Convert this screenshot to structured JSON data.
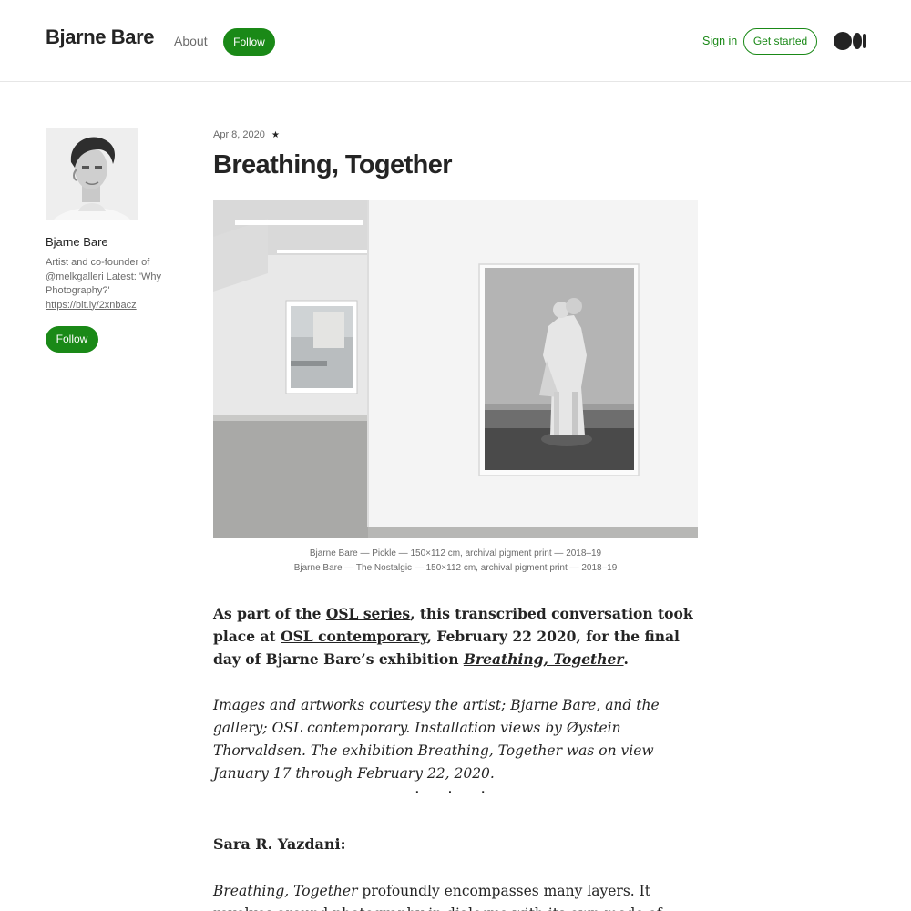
{
  "header": {
    "publication_name": "Bjarne Bare",
    "about_label": "About",
    "follow_label": "Follow",
    "sign_in_label": "Sign in",
    "get_started_label": "Get started",
    "logo_icon": "medium-logo-icon",
    "accent_color": "#1a8917"
  },
  "author": {
    "name": "Bjarne Bare",
    "bio": "Artist and co-founder of @melkgalleri Latest: 'Why Photography?'",
    "link": "https://bit.ly/2xnbacz",
    "follow_label": "Follow"
  },
  "article": {
    "date": "Apr 8, 2020",
    "star_icon": "★",
    "title": "Breathing, Together",
    "caption_line1": "Bjarne Bare — Pickle — 150×112 cm, archival pigment print — 2018–19",
    "caption_line2": "Bjarne Bare — The Nostalgic — 150×112 cm, archival pigment print — 2018–19",
    "intro": {
      "t1": "As part of the ",
      "link1": "OSL series",
      "t2": ", this transcribed conversation took place at ",
      "link2": "OSL contemporary",
      "t3": ", February 22 2020, for the final day of Bjarne Bare’s exhibition ",
      "link3": "Breathing, Together",
      "t4": "."
    },
    "credits": "Images and artworks courtesy the artist; Bjarne Bare, and the gallery; OSL contemporary. Installation views by Øystein Thorvaldsen. The exhibition Breathing, Together was on view January 17 through February 22, 2020.",
    "divider": "· · ·",
    "speaker": "Sara R. Yazdani:",
    "speech": {
      "em": "Breathing, Together",
      "rest": " profoundly encompasses many layers. It revolves around photography in dialogue with its own mode of existence. I would"
    }
  }
}
